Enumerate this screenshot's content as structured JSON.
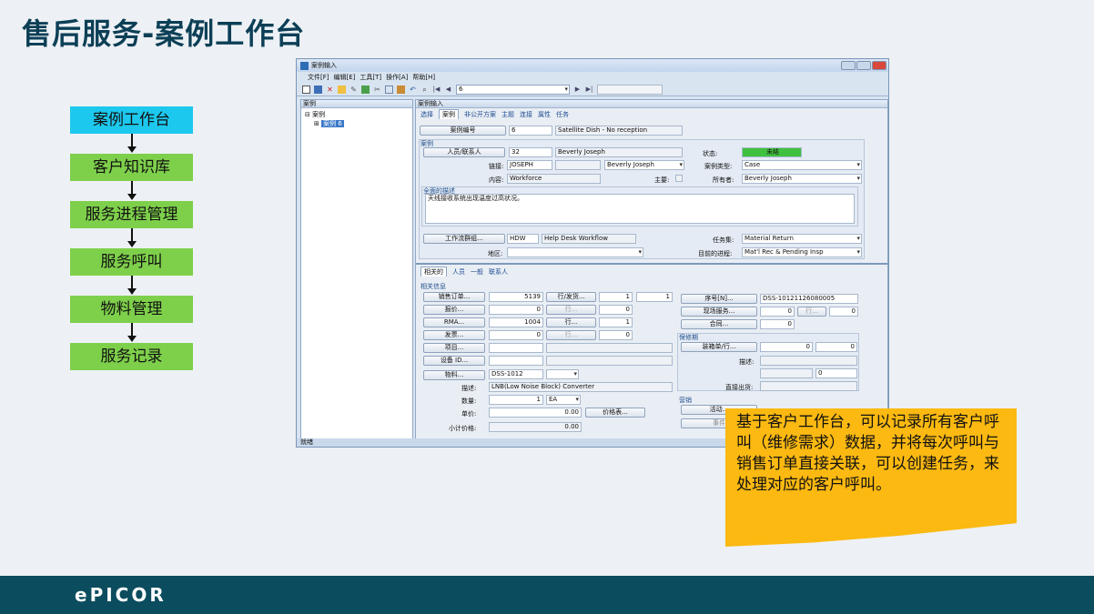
{
  "slide": {
    "title": "售后服务-案例工作台",
    "flow": [
      "案例工作台",
      "客户知识库",
      "服务进程管理",
      "服务呼叫",
      "物料管理",
      "服务记录"
    ],
    "callout": "基于客户工作台，可以记录所有客户呼叫（维修需求）数据，并将每次呼叫与销售订单直接关联，可以创建任务，来处理对应的客户呼叫。",
    "logo": "ePICOR"
  },
  "app": {
    "window_title": "案例输入",
    "menu": [
      "文件[F]",
      "编辑[E]",
      "工具[T]",
      "操作[A]",
      "帮助[H]"
    ],
    "nav_value": "6",
    "tree": {
      "header": "案例",
      "root": "案例",
      "child": "案例 6"
    },
    "main_header": "案例输入",
    "tabs": [
      "选择",
      "案例",
      "非公开方案",
      "主题",
      "连接",
      "属性",
      "任务"
    ],
    "case": {
      "case_number_btn": "案例编号",
      "case_number": "6",
      "case_desc": "Satellite Dish - No reception",
      "group_title": "案例",
      "person_btn": "人员/联系人",
      "person_id": "32",
      "person_name": "Beverly Joseph",
      "status_label": "状态:",
      "status_value": "未结",
      "link_label": "链接:",
      "link_value": "JOSEPH",
      "link_name": "Beverly Joseph",
      "case_type_label": "案例类型:",
      "case_type": "Case",
      "content_label": "内容:",
      "content_value": "Workforce",
      "primary_label": "主要:",
      "owner_label": "所有者:",
      "owner": "Beverly Joseph",
      "desc_title": "全面的描述",
      "desc_text": "天线接收系统出现温度过高状况。",
      "workflow_btn": "工作流群组...",
      "workflow_code": "HDW",
      "workflow_name": "Help Desk Workflow",
      "task_set_label": "任务集:",
      "task_set": "Material Return",
      "region_label": "地区:",
      "current_step_label": "目前的进程:",
      "current_step": "Mat'l Rec & Pending Insp"
    },
    "lower_tabs": [
      "相关的",
      "人员",
      "一般",
      "联系人"
    ],
    "related": {
      "group_title": "相关信息",
      "sales_order_btn": "销售订单...",
      "sales_order": "5139",
      "line_rel_btn": "行/发货...",
      "line_val": "1",
      "rel_val": "1",
      "quote_btn": "报价...",
      "quote": "0",
      "quote_line_btn": "行...",
      "quote_line": "0",
      "rma_btn": "RMA...",
      "rma": "1004",
      "rma_line_btn": "行...",
      "rma_line": "1",
      "invoice_btn": "发票...",
      "invoice": "0",
      "invoice_line_btn": "行...",
      "invoice_line": "0",
      "project_btn": "项目...",
      "equip_btn": "设备 ID...",
      "part_btn": "物料...",
      "part": "DSS-1012",
      "desc_label": "描述:",
      "desc": "LNB(Low Noise Block) Converter",
      "qty_label": "数量:",
      "qty": "1",
      "uom": "EA",
      "price_label": "单价:",
      "price": "0.00",
      "price_list_btn": "价格表...",
      "subtotal_label": "小计价格:",
      "subtotal": "0.00",
      "serial_btn": "序号[N]...",
      "serial": "DSS-10121126080005",
      "field_service_btn": "现场服务...",
      "fs_val": "0",
      "fs_line_btn": "行...",
      "fs_line": "0",
      "contract_btn": "合同...",
      "contract": "0",
      "warranty_title": "保修期",
      "kit_btn": "装箱单/行...",
      "kit_a": "0",
      "kit_b": "0",
      "w_desc_label": "描述:",
      "w_val": "0",
      "direct_ship_label": "直接出货:",
      "marketing_title": "营销",
      "activity_btn": "活动...",
      "event_btn": "事件"
    },
    "status_bar": "就绪"
  }
}
